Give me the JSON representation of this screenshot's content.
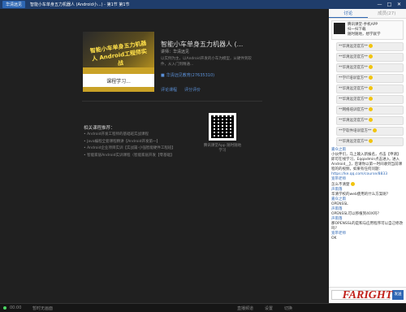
{
  "window": {
    "logo": "华清远见",
    "title": "智能小车单身五力机器人 (Android小...) - 第1节 第1节",
    "min": "—",
    "max": "□",
    "close": "✕"
  },
  "course": {
    "cover_title": "智能小车单身五力机器人 Android工程师实战",
    "play_label": "课程学习...",
    "title": "智能小车单身五力机器人 (...",
    "lecturer": "讲师：华清远见",
    "desc": "以实例为主，以Android开发的小车为模型，从硬件到软件，从入门到精通...",
    "org": "华清远见教育(27635310)",
    "link_comment": "评论课程",
    "link_rating": "评分评价"
  },
  "related": {
    "heading": "相关课程推荐：",
    "items": [
      "Android开发工程师的基础班实战课程",
      "Java编程全套课程精讲【Android开发第一】",
      "Android企业项目实训【实战篇·小强智能硬件工程班】",
      "智能家居Android实训课程（智能家居开发【零基础】"
    ]
  },
  "qr": {
    "caption": "腾讯课堂App 随时随地学习"
  },
  "footer": {
    "time": "00:00",
    "status": "暂时无画面",
    "right1": "直播频道",
    "right2": "设置",
    "right3": "切换"
  },
  "sidebar": {
    "tabs": [
      "讨论",
      "成员(27)"
    ],
    "card": {
      "title": "腾讯课堂-手机APP",
      "line1": "扫一扫下载",
      "line2": "随时随地，想学就学"
    },
    "bubbles": [
      "**华清远见官方**",
      "**华清远见官方**",
      "**华清远见官方**",
      "**学IT培训官方**",
      "**华清远见官方**",
      "**华清远见官方**",
      "**网络培训官方**",
      "**华清远见官方**",
      "**学软件培训官方**",
      "**华清远见官方**"
    ],
    "name1": "嘉众之雨",
    "msg1": "小伙伴们，马上输入新报名，点击【申请】即可在线学习，Eqqadmin点击进入, 进入 Android__】，后请你以第一时间收到当前课程的的视频，如果有任何问题：",
    "link": "https://ke.qq.com/course/8833",
    "name2": "宽带老师",
    "msg2": "怎么不清楚",
    "name3": "声雨落",
    "msg3": "华清学校的web使用的什么方案呢？",
    "name4": "嘉众之雨",
    "msg4": "OPENSSL",
    "name5": "声雨落",
    "msg5": "OPENSSL可以移植到40X吗？",
    "name6": "声雨落",
    "msg6": "那OPENSSL的是和与应用程序可以自己修改吗？",
    "name7": "宽带老师",
    "msg7": "OK",
    "send": "发送",
    "watermark": "FARIGHT"
  }
}
